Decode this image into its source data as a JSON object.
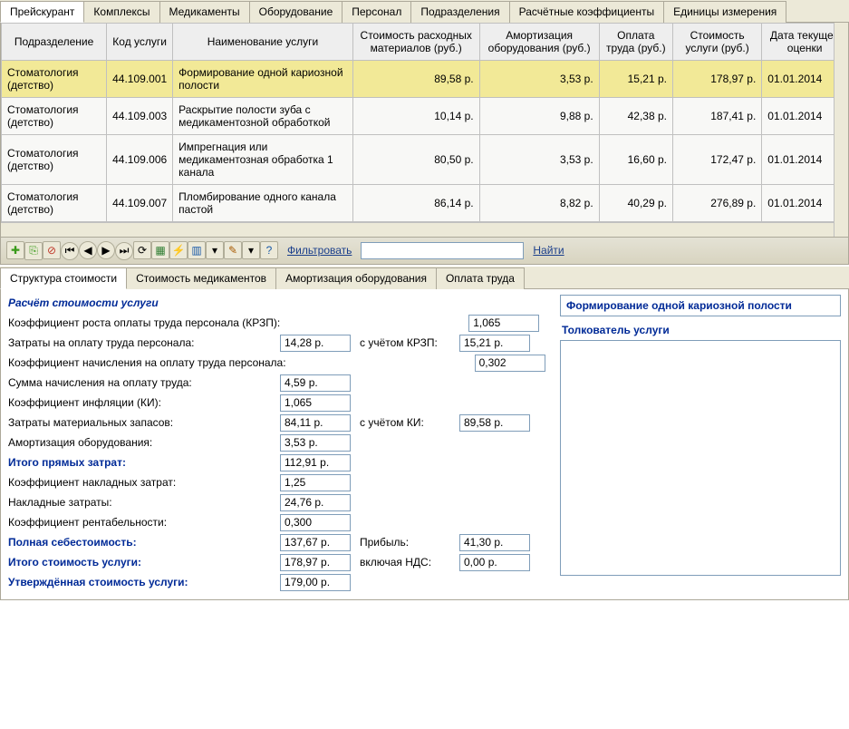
{
  "tabs_top": [
    {
      "label": "Прейскурант",
      "active": true
    },
    {
      "label": "Комплексы"
    },
    {
      "label": "Медикаменты"
    },
    {
      "label": "Оборудование"
    },
    {
      "label": "Персонал"
    },
    {
      "label": "Подразделения"
    },
    {
      "label": "Расчётные коэффициенты"
    },
    {
      "label": "Единицы измерения"
    }
  ],
  "grid": {
    "headers": [
      "Подразделение",
      "Код услуги",
      "Наименование услуги",
      "Стоимость расходных материалов (руб.)",
      "Амортизация оборудования (руб.)",
      "Оплата труда (руб.)",
      "Стоимость услуги (руб.)",
      "Дата текущей оценки"
    ],
    "rows": [
      {
        "sel": true,
        "dep": "Стоматология (детство)",
        "code": "44.109.001",
        "name": "Формирование одной кариозной полости",
        "mat": "89,58 р.",
        "amort": "3,53 р.",
        "labor": "15,21 р.",
        "cost": "178,97 р.",
        "date": "01.01.2014"
      },
      {
        "dep": "Стоматология (детство)",
        "code": "44.109.003",
        "name": "Раскрытие полости зуба с медикаментозной обработкой",
        "mat": "10,14 р.",
        "amort": "9,88 р.",
        "labor": "42,38 р.",
        "cost": "187,41 р.",
        "date": "01.01.2014"
      },
      {
        "dep": "Стоматология (детство)",
        "code": "44.109.006",
        "name": "Импрегнация или медикаментозная обработка 1 канала",
        "mat": "80,50 р.",
        "amort": "3,53 р.",
        "labor": "16,60 р.",
        "cost": "172,47 р.",
        "date": "01.01.2014"
      },
      {
        "dep": "Стоматология (детство)",
        "code": "44.109.007",
        "name": "Пломбирование одного канала пастой",
        "mat": "86,14 р.",
        "amort": "8,82 р.",
        "labor": "40,29 р.",
        "cost": "276,89 р.",
        "date": "01.01.2014"
      }
    ]
  },
  "toolbar": {
    "icons": [
      {
        "name": "add-icon",
        "glyph": "✚",
        "color": "#3a9a1a"
      },
      {
        "name": "copy-icon",
        "glyph": "⎘",
        "color": "#3a9a1a"
      },
      {
        "name": "delete-icon",
        "glyph": "⊘",
        "color": "#c0392b"
      },
      {
        "name": "nav-first-icon",
        "glyph": "⏮",
        "round": true
      },
      {
        "name": "nav-prev-icon",
        "glyph": "◀",
        "round": true
      },
      {
        "name": "nav-next-icon",
        "glyph": "▶",
        "round": true
      },
      {
        "name": "nav-last-icon",
        "glyph": "⏭",
        "round": true
      },
      {
        "name": "refresh-icon",
        "glyph": "⟳"
      },
      {
        "name": "export-xls-icon",
        "glyph": "▦",
        "color": "#2e7d32"
      },
      {
        "name": "bolt-icon",
        "glyph": "⚡",
        "color": "#c79a00"
      },
      {
        "name": "chart-icon",
        "glyph": "▥",
        "color": "#1a5aa8"
      },
      {
        "name": "dropdown-icon",
        "glyph": "▾"
      },
      {
        "name": "tool-icon",
        "glyph": "✎",
        "color": "#a85a00"
      },
      {
        "name": "dropdown2-icon",
        "glyph": "▾"
      },
      {
        "name": "help-icon",
        "glyph": "?",
        "color": "#1a5aa8"
      }
    ],
    "filter_label": "Фильтровать",
    "filter_value": "",
    "find_label": "Найти"
  },
  "tabs_bottom": [
    {
      "label": "Структура стоимости",
      "active": true
    },
    {
      "label": "Стоимость медикаментов"
    },
    {
      "label": "Амортизация оборудования"
    },
    {
      "label": "Оплата труда"
    }
  ],
  "calc": {
    "title": "Расчёт стоимости услуги",
    "krzp_label": "Коэффициент роста оплаты труда персонала (КРЗП):",
    "krzp": "1,065",
    "labor_label": "Затраты на оплату труда персонала:",
    "labor": "14,28 р.",
    "labor_k_label": "с учётом КРЗП:",
    "labor_k": "15,21 р.",
    "accrual_coef_label": "Коэффициент начисления на оплату труда персонала:",
    "accrual_coef": "0,302",
    "accrual_sum_label": "Сумма начисления на оплату труда:",
    "accrual_sum": "4,59 р.",
    "ki_label": "Коэффициент инфляции (КИ):",
    "ki": "1,065",
    "mat_label": "Затраты материальных запасов:",
    "mat": "84,11 р.",
    "mat_k_label": "с учётом КИ:",
    "mat_k": "89,58 р.",
    "amort_label": "Амортизация оборудования:",
    "amort": "3,53 р.",
    "direct_label": "Итого прямых затрат:",
    "direct": "112,91 р.",
    "overhead_coef_label": "Коэффициент накладных затрат:",
    "overhead_coef": "1,25",
    "overhead_label": "Накладные затраты:",
    "overhead": "24,76 р.",
    "profit_coef_label": "Коэффициент рентабельности:",
    "profit_coef": "0,300",
    "full_cost_label": "Полная себестоимость:",
    "full_cost": "137,67 р.",
    "profit_label": "Прибыль:",
    "profit": "41,30 р.",
    "total_label": "Итого стоимость услуги:",
    "total": "178,97 р.",
    "vat_label": "включая НДС:",
    "vat": "0,00 р.",
    "approved_label": "Утверждённая стоимость услуги:",
    "approved": "179,00 р."
  },
  "right": {
    "service_name": "Формирование одной кариозной полости",
    "interpreter_title": "Толкователь услуги",
    "interpreter_text": ""
  }
}
